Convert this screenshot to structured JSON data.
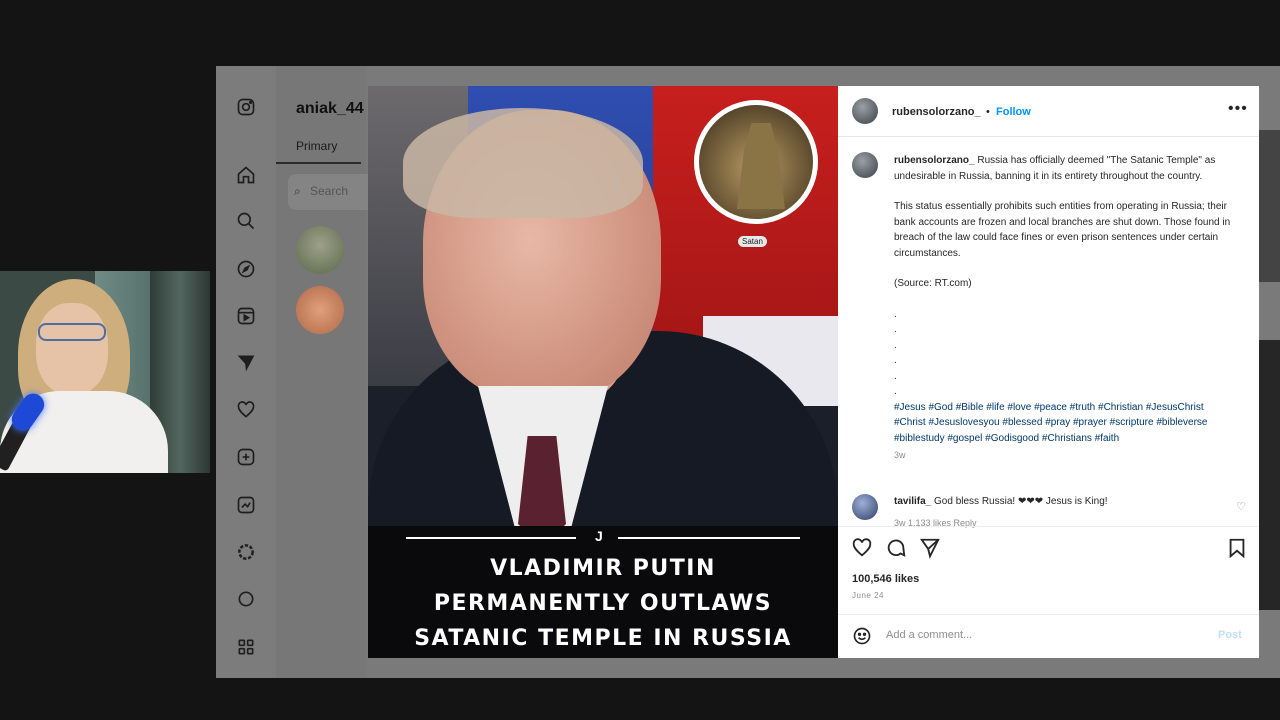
{
  "inbox": {
    "username": "aniak_44",
    "tab_primary": "Primary",
    "search_placeholder": "Search"
  },
  "post": {
    "headline": {
      "line1": "VLADIMIR PUTIN",
      "line2": "PERMANENTLY OUTLAWS",
      "line3": "SATANIC TEMPLE IN RUSSIA"
    },
    "badge_label": "Satan"
  },
  "details": {
    "header_username": "rubensolorzano_",
    "separator": "•",
    "follow_label": "Follow",
    "more_label": "•••",
    "caption_username": "rubensolorzano_",
    "caption_p1": "Russia has officially deemed \"The Satanic Temple\" as undesirable in Russia, banning it in its entirety throughout the country.",
    "caption_p2": "This status essentially prohibits such entities from operating in Russia; their bank accounts are frozen and local branches are shut down. Those found in breach of the law could face fines or even prison sentences under certain circumstances.",
    "caption_p3": "(Source: RT.com)",
    "dots": [
      ".",
      ".",
      ".",
      ".",
      ".",
      "."
    ],
    "hashtags": "#Jesus #God #Bible #life #love #peace #truth #Christian #JesusChrist #Christ #Jesuslovesyou #blessed #pray #prayer #scripture #bibleverse #biblestudy #gospel #Godisgood #Christians #faith",
    "caption_age": "3w",
    "comment_username": "tavilifa_",
    "comment_text": "God bless Russia! ❤❤❤ Jesus is King!",
    "comment_meta": "3w   1,133 likes   Reply",
    "likes": "100,546 likes",
    "date": "June 24",
    "add_comment_placeholder": "Add a comment...",
    "post_label": "Post"
  },
  "colors": {
    "follow_blue": "#0095f6",
    "page_background": "#141414",
    "dim_overlay": "#7a7a7a"
  },
  "icons": {
    "nav": [
      "instagram-icon",
      "home-icon",
      "search-icon",
      "explore-icon",
      "reels-icon",
      "messages-icon",
      "heart-icon",
      "create-icon",
      "dashboard-icon",
      "profile-icon",
      "more-icon"
    ]
  }
}
